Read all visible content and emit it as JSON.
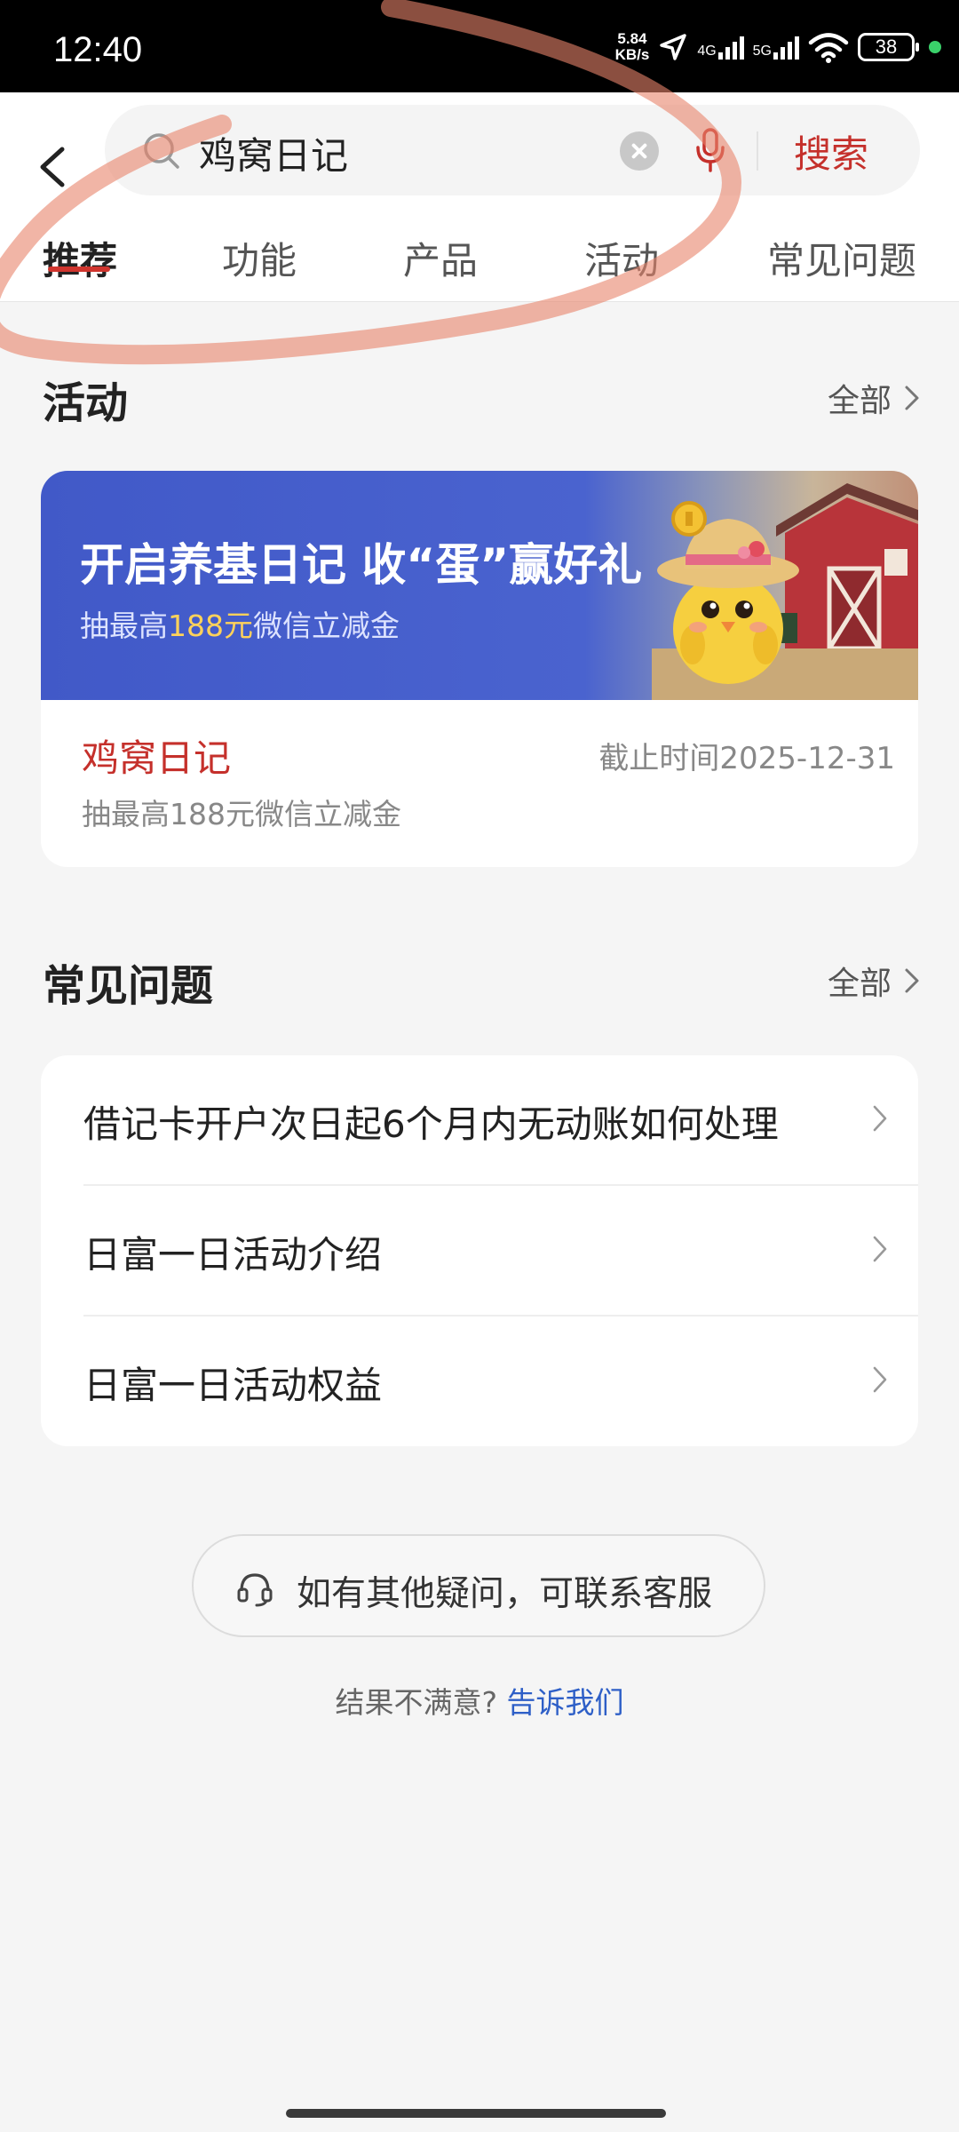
{
  "status_bar": {
    "time": "12:40",
    "net_speed_value": "5.84",
    "net_speed_unit": "KB/s",
    "signal_1": "4G",
    "signal_2": "5G",
    "battery": "38"
  },
  "search": {
    "query": "鸡窝日记",
    "button_label": "搜索"
  },
  "tabs": [
    {
      "label": "推荐",
      "active": true
    },
    {
      "label": "功能"
    },
    {
      "label": "产品"
    },
    {
      "label": "活动"
    },
    {
      "label": "常见问题"
    }
  ],
  "activity_section": {
    "title": "活动",
    "more_label": "全部",
    "card": {
      "banner_title": "开启养基日记 收“蛋”赢好礼",
      "banner_sub_prefix": "抽最高",
      "banner_sub_amount": "188元",
      "banner_sub_suffix": "微信立减金",
      "title": "鸡窝日记",
      "deadline": "截止时间2025-12-31",
      "description": "抽最高188元微信立减金"
    }
  },
  "faq_section": {
    "title": "常见问题",
    "more_label": "全部",
    "items": [
      {
        "label": "借记卡开户次日起6个月内无动账如何处理"
      },
      {
        "label": "日富一日活动介绍"
      },
      {
        "label": "日富一日活动权益"
      }
    ]
  },
  "service_button": {
    "label": "如有其他疑问，可联系客服"
  },
  "feedback": {
    "prefix": "结果不满意? ",
    "link": "告诉我们"
  },
  "colors": {
    "accent_red": "#c5302b",
    "banner_blue": "#4159c8",
    "link_blue": "#2e5fc7"
  }
}
